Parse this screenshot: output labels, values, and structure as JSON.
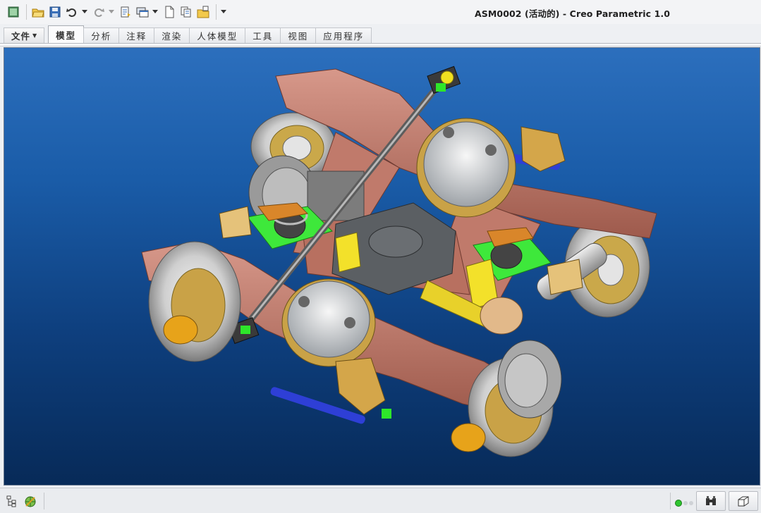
{
  "window": {
    "title": "ASM0002 (活动的) - Creo Parametric 1.0"
  },
  "quick_access": {
    "items": [
      "new-window-icon",
      "open-icon",
      "save-icon",
      "undo-icon",
      "redo-icon",
      "regenerate-icon",
      "windows-icon",
      "new-icon",
      "copy-icon",
      "close-icon"
    ]
  },
  "ribbon": {
    "file_label": "文件",
    "tabs": [
      {
        "label": "模型",
        "active": true
      },
      {
        "label": "分析",
        "active": false
      },
      {
        "label": "注释",
        "active": false
      },
      {
        "label": "渲染",
        "active": false
      },
      {
        "label": "人体模型",
        "active": false
      },
      {
        "label": "工具",
        "active": false
      },
      {
        "label": "视图",
        "active": false
      },
      {
        "label": "应用程序",
        "active": false
      }
    ]
  },
  "viewport": {
    "model_name": "ASM0002",
    "background_top": "#2c6fbd",
    "background_bottom": "#072a58"
  },
  "statusbar": {
    "left_icons": [
      "model-tree-icon",
      "web-browser-icon"
    ],
    "right_icons": [
      "find-icon",
      "selection-filter-icon"
    ],
    "status_light_color": "#2fc52f"
  }
}
